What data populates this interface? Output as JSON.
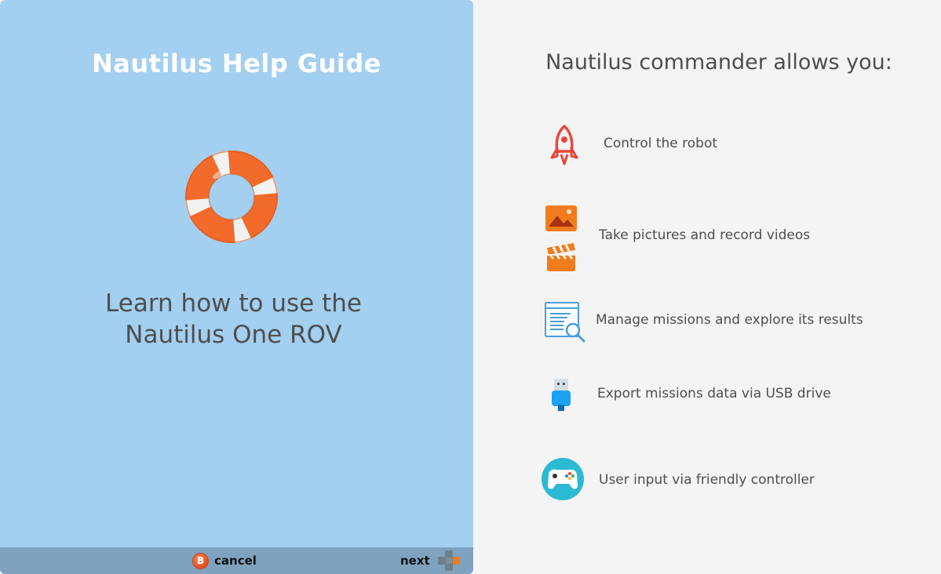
{
  "left_panel": {
    "title": "Nautilus Help Guide",
    "intro_line1": "Learn how to use the",
    "intro_line2": "Nautilus One ROV",
    "bottom_bar": {
      "cancel_key": "B",
      "cancel_label": "cancel",
      "next_label": "next"
    }
  },
  "right_panel": {
    "heading": "Nautilus commander allows you:",
    "features": [
      {
        "label": "Control the robot",
        "icon": "rocket-icon"
      },
      {
        "label": "Take pictures and record videos",
        "icon": "picture-and-clapperboard-icon"
      },
      {
        "label": "Manage missions and explore its results",
        "icon": "document-search-icon"
      },
      {
        "label": "Export missions data via USB drive",
        "icon": "usb-drive-icon"
      },
      {
        "label": "User input via friendly controller",
        "icon": "gamepad-icon"
      }
    ]
  },
  "colors": {
    "left_background": "#a3cff0",
    "right_background": "#f4f4f4",
    "bottom_bar": "#7fa3bf",
    "accent_orange": "#f07c1e"
  }
}
